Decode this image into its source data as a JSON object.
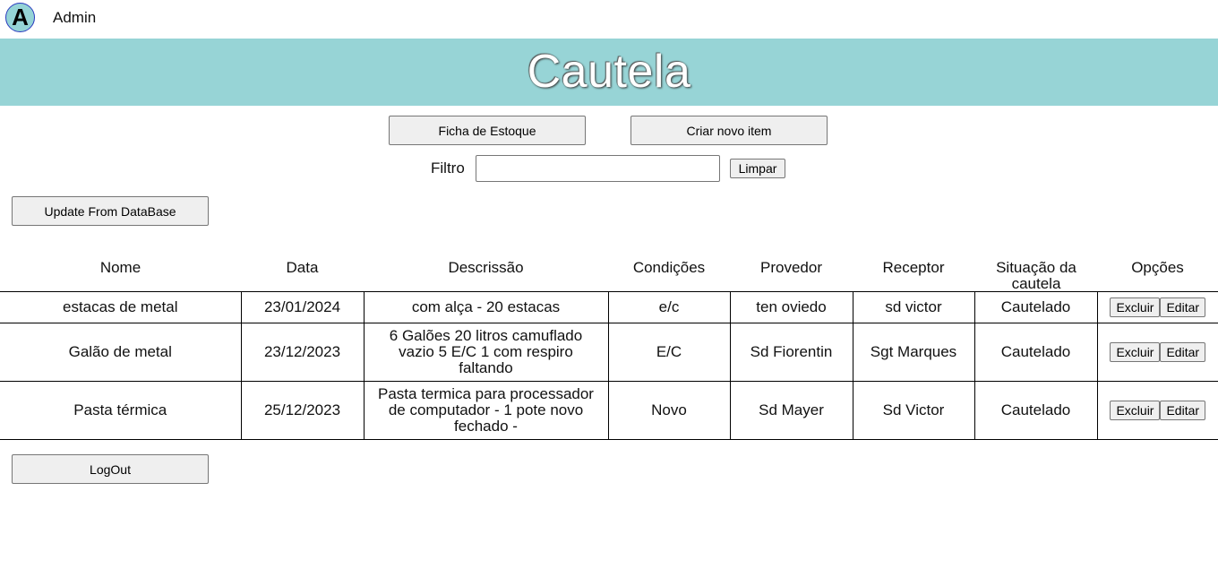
{
  "user": {
    "avatar_letter": "A",
    "name": "Admin"
  },
  "page": {
    "title": "Cautela"
  },
  "toolbar": {
    "stock_button": "Ficha de Estoque",
    "create_button": "Criar novo item",
    "filter_label": "Filtro",
    "filter_value": "",
    "clear_button": "Limpar",
    "update_button": "Update From DataBase",
    "logout_button": "LogOut"
  },
  "table": {
    "headers": [
      "Nome",
      "Data",
      "Descrissão",
      "Condições",
      "Provedor",
      "Receptor",
      "Situação da cautela",
      "Opções"
    ],
    "delete_label": "Excluir",
    "edit_label": "Editar",
    "rows": [
      {
        "nome": "estacas de metal",
        "data": "23/01/2024",
        "descricao": "com alça - 20 estacas",
        "condicoes": "e/c",
        "provedor": "ten oviedo",
        "receptor": "sd victor",
        "situacao": "Cautelado"
      },
      {
        "nome": "Galão de metal",
        "data": "23/12/2023",
        "descricao": "6 Galões 20 litros camuflado vazio 5 E/C 1 com respiro faltando",
        "condicoes": "E/C",
        "provedor": "Sd Fiorentin",
        "receptor": "Sgt Marques",
        "situacao": "Cautelado"
      },
      {
        "nome": "Pasta térmica",
        "data": "25/12/2023",
        "descricao": "Pasta termica para processador de computador - 1 pote novo fechado -",
        "condicoes": "Novo",
        "provedor": "Sd Mayer",
        "receptor": "Sd Victor",
        "situacao": "Cautelado"
      }
    ]
  }
}
